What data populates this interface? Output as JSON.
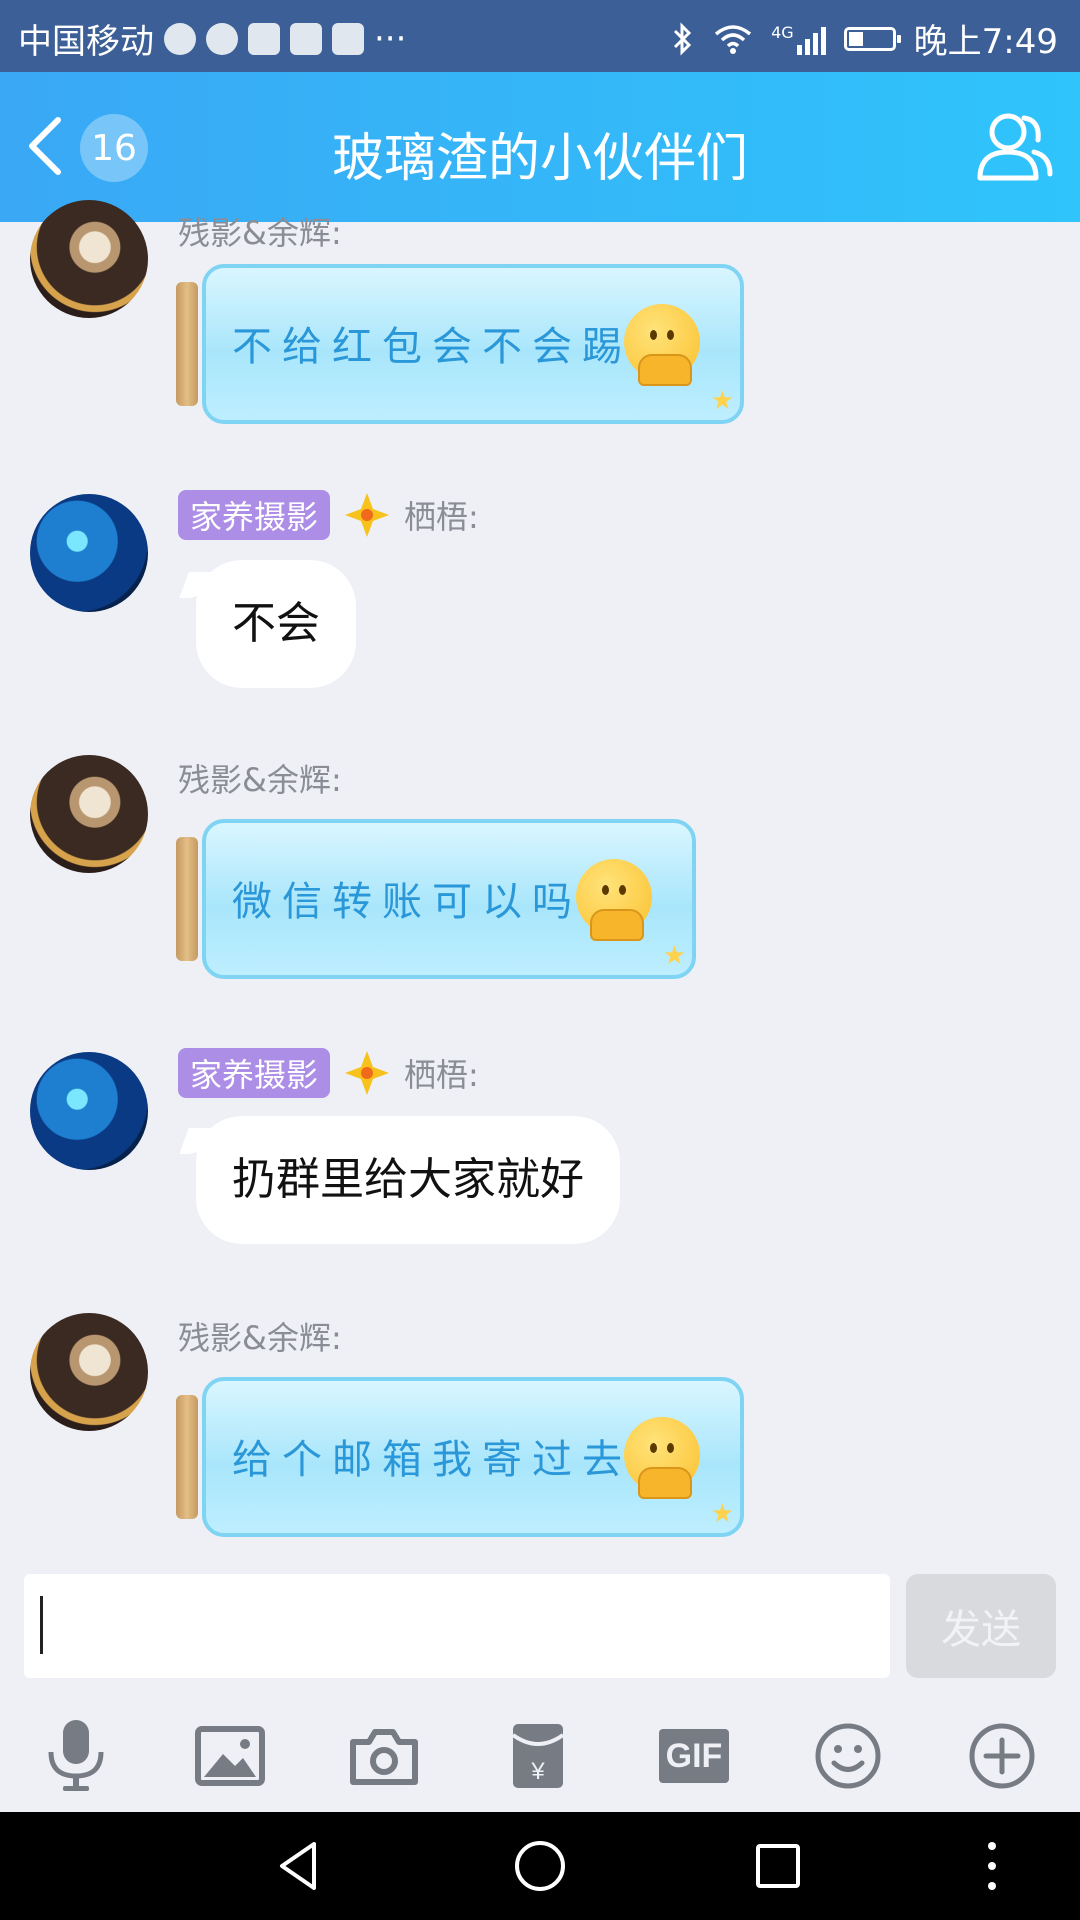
{
  "status_bar": {
    "carrier": "中国移动",
    "network": "4G",
    "time": "晚上7:49"
  },
  "header": {
    "title": "玻璃渣的小伙伴们",
    "unread_count": "16"
  },
  "messages": [
    {
      "sender": "残影&余辉:",
      "text": "不给红包会不会踢"
    },
    {
      "tag": "家养摄影",
      "sender": "栖梧:",
      "text": "不会"
    },
    {
      "sender": "残影&余辉:",
      "text": "微信转账可以吗"
    },
    {
      "tag": "家养摄影",
      "sender": "栖梧:",
      "text": "扔群里给大家就好"
    },
    {
      "sender": "残影&余辉:",
      "text": "给个邮箱我寄过去"
    }
  ],
  "input": {
    "value": "",
    "send_label": "发送"
  },
  "toolbar": {
    "gif_label": "GIF"
  },
  "colors": {
    "header_start": "#3aa8f5",
    "header_end": "#2fc4fb",
    "status_bar": "#3b5f96",
    "tag_bg": "#ad8ee6",
    "bottle_text": "#2a97d8"
  },
  "icons": [
    "back-arrow-icon",
    "group-members-icon",
    "microphone-icon",
    "image-icon",
    "camera-icon",
    "red-packet-icon",
    "gif-icon",
    "emoji-icon",
    "plus-icon",
    "nav-back-icon",
    "nav-home-icon",
    "nav-recents-icon",
    "nav-menu-icon"
  ]
}
